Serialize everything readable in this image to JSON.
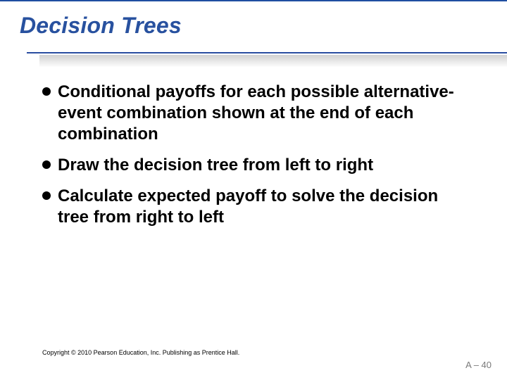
{
  "title": "Decision Trees",
  "bullets": [
    "Conditional payoffs for each possible alternative-event combination shown at the end of each combination",
    "Draw the decision tree from left to right",
    "Calculate expected payoff to solve the decision tree from right to left"
  ],
  "copyright": "Copyright © 2010 Pearson Education, Inc. Publishing as Prentice Hall.",
  "page_number": "A – 40"
}
